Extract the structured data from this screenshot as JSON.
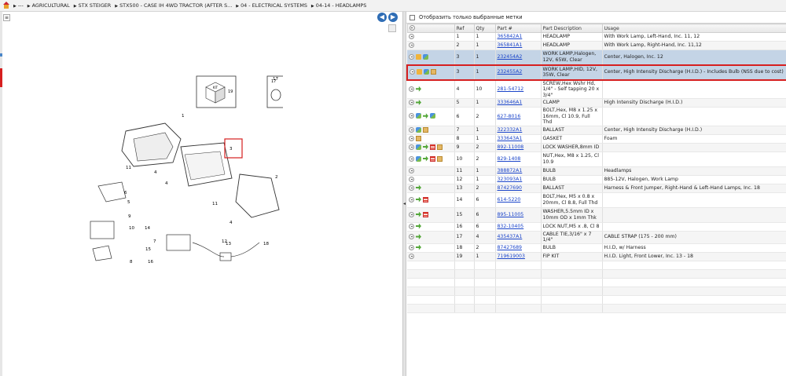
{
  "breadcrumb": [
    {
      "label": "---"
    },
    {
      "label": "AGRICULTURAL"
    },
    {
      "label": "STX STEIGER"
    },
    {
      "label": "STX500 - CASE IH 4WD TRACTOR (AFTER S..."
    },
    {
      "label": "04 - ELECTRICAL SYSTEMS"
    },
    {
      "label": "04-14 - HEADLAMPS"
    }
  ],
  "nav": {
    "prev": "◀",
    "next": "▶"
  },
  "filter": {
    "label": "Отобразить только выбранные метки"
  },
  "table": {
    "headers": [
      "",
      "Ref",
      "Qty",
      "Part #",
      "Part Description",
      "Usage"
    ],
    "rows": [
      {
        "icons": [
          "add-icon"
        ],
        "ref": "1",
        "qty": "1",
        "part": "365842A1",
        "desc": "HEADLAMP",
        "usage": "With Work Lamp, Left-Hand, Inc. 11, 12",
        "state": ""
      },
      {
        "icons": [
          "add-icon"
        ],
        "ref": "2",
        "qty": "1",
        "part": "365841A1",
        "desc": "HEADLAMP",
        "usage": "With Work Lamp, Right-Hand, Inc. 11,12",
        "state": ""
      },
      {
        "icons": [
          "add-icon",
          "folder-icon",
          "swap-icon"
        ],
        "ref": "3",
        "qty": "1",
        "part": "232454A2",
        "desc": "WORK LAMP,Halogen, 12V, 65W, Clear",
        "usage": "Center, Halogen, Inc. 12",
        "state": "sel"
      },
      {
        "icons": [
          "add-icon",
          "folder-icon",
          "swap-icon",
          "box-icon"
        ],
        "ref": "3",
        "qty": "1",
        "part": "232455A2",
        "desc": "WORK LAMP,HID, 12V, 35W, Clear",
        "usage": "Center, High Intensity Discharge (H.I.D.) - Includes Bulb (NSS due to cost)",
        "state": "hl"
      },
      {
        "icons": [
          "add-icon",
          "arrow-icon"
        ],
        "ref": "4",
        "qty": "10",
        "part": "281-54712",
        "desc": "SCREW,Hex Wshr Hd, 1/4\" - Self tapping 20 x 3/4\"",
        "usage": "",
        "state": ""
      },
      {
        "icons": [
          "add-icon",
          "arrow-icon"
        ],
        "ref": "5",
        "qty": "1",
        "part": "333646A1",
        "desc": "CLAMP",
        "usage": "High Intensity Discharge (H.I.D.)",
        "state": ""
      },
      {
        "icons": [
          "add-icon",
          "swap-icon",
          "arrow-icon",
          "swap-icon"
        ],
        "ref": "6",
        "qty": "2",
        "part": "627-8016",
        "desc": "BOLT,Hex, M8 x 1.25 x 16mm, Cl 10.9, Full Thd",
        "usage": "",
        "state": ""
      },
      {
        "icons": [
          "add-icon",
          "swap-icon",
          "box-icon"
        ],
        "ref": "7",
        "qty": "1",
        "part": "322332A1",
        "desc": "BALLAST",
        "usage": "Center, High Intensity Discharge (H.I.D.)",
        "state": ""
      },
      {
        "icons": [
          "add-icon",
          "box-icon"
        ],
        "ref": "8",
        "qty": "1",
        "part": "333643A1",
        "desc": "GASKET",
        "usage": "Foam",
        "state": ""
      },
      {
        "icons": [
          "add-icon",
          "swap-icon",
          "arrow-icon",
          "list-icon",
          "box-icon"
        ],
        "ref": "9",
        "qty": "2",
        "part": "892-11008",
        "desc": "LOCK WASHER,8mm ID",
        "usage": "",
        "state": ""
      },
      {
        "icons": [
          "add-icon",
          "swap-icon",
          "arrow-icon",
          "list-icon",
          "box-icon"
        ],
        "ref": "10",
        "qty": "2",
        "part": "829-1408",
        "desc": "NUT,Hex, M8 x 1.25, Cl 10.9",
        "usage": "",
        "state": ""
      },
      {
        "icons": [
          "add-icon"
        ],
        "ref": "11",
        "qty": "1",
        "part": "388872A1",
        "desc": "BULB",
        "usage": "Headlamps",
        "state": ""
      },
      {
        "icons": [
          "add-icon"
        ],
        "ref": "12",
        "qty": "1",
        "part": "323093A1",
        "desc": "BULB",
        "usage": "885-12V, Halogen, Work Lamp",
        "state": ""
      },
      {
        "icons": [
          "add-icon",
          "arrow-icon"
        ],
        "ref": "13",
        "qty": "2",
        "part": "87427690",
        "desc": "BALLAST",
        "usage": "Harness & Front Jumper, Right-Hand & Left-Hand Lamps, Inc. 18",
        "state": ""
      },
      {
        "icons": [
          "add-icon",
          "arrow-icon",
          "list-icon"
        ],
        "ref": "14",
        "qty": "6",
        "part": "614-5220",
        "desc": "BOLT,Hex, M5 x 0.8 x 20mm, Cl 8.8, Full Thd",
        "usage": "",
        "state": ""
      },
      {
        "icons": [
          "add-icon",
          "arrow-icon",
          "list-icon"
        ],
        "ref": "15",
        "qty": "6",
        "part": "895-11005",
        "desc": "WASHER,5.5mm ID x 10mm OD x 1mm Thk",
        "usage": "",
        "state": ""
      },
      {
        "icons": [
          "add-icon",
          "arrow-icon"
        ],
        "ref": "16",
        "qty": "6",
        "part": "832-10405",
        "desc": "LOCK NUT,M5 x .8, Cl 8",
        "usage": "",
        "state": ""
      },
      {
        "icons": [
          "add-icon",
          "arrow-icon"
        ],
        "ref": "17",
        "qty": "4",
        "part": "435437A1",
        "desc": "CABLE TIE,3/16\" x 7 1/4\"",
        "usage": "CABLE STRAP (175 - 200 mm)",
        "state": ""
      },
      {
        "icons": [
          "add-icon",
          "arrow-icon"
        ],
        "ref": "18",
        "qty": "2",
        "part": "87427689",
        "desc": "BULB",
        "usage": "H.I.D, w/ Harness",
        "state": ""
      },
      {
        "icons": [
          "add-icon"
        ],
        "ref": "19",
        "qty": "1",
        "part": "719619003",
        "desc": "FIP KIT",
        "usage": "H.I.D. Light, Front Lower, Inc. 13 - 18",
        "state": ""
      }
    ]
  },
  "diagram": {
    "callouts": [
      "1",
      "2",
      "3",
      "4",
      "4",
      "4",
      "5",
      "6",
      "7",
      "8",
      "9",
      "10",
      "11",
      "11",
      "12",
      "13",
      "14",
      "15",
      "16",
      "17",
      "18",
      "19"
    ],
    "kit_label": "KIT",
    "kit_ref": "19",
    "tie_ref": "17"
  },
  "colors": {
    "highlight": "#d61f1f",
    "selected_row": "#c4d4e6",
    "link": "#1a44c9",
    "nav": "#2f6db5"
  }
}
